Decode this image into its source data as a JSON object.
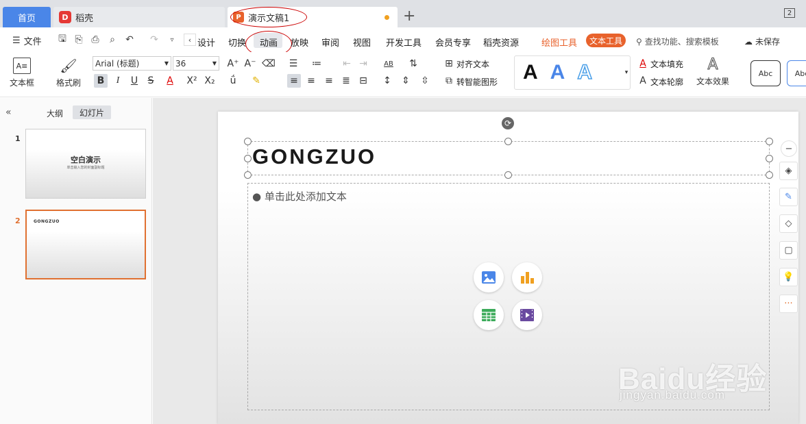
{
  "tabs": {
    "home": "首页",
    "daoke": "稻壳",
    "daoke_icon_letter": "D",
    "doc": "演示文稿1",
    "doc_icon_letter": "P",
    "add": "+",
    "window_num": "2"
  },
  "menu": {
    "file": "文件",
    "items": [
      "设计",
      "切换",
      "动画",
      "放映",
      "审阅",
      "视图",
      "开发工具",
      "会员专享",
      "稻壳资源"
    ],
    "drawing_tools": "绘图工具",
    "text_tools": "文本工具",
    "search_placeholder": "查找功能、搜索模板",
    "unsaved": "未保存"
  },
  "ribbon": {
    "textbox": "文本框",
    "format_painter": "格式刷",
    "font_name": "Arial (标题)",
    "font_size": "36",
    "align_text": "对齐文本",
    "smart_shape": "转智能图形",
    "text_fill": "文本填充",
    "text_outline": "文本轮廓",
    "text_effect": "文本效果",
    "wordart_letter": "A",
    "style1": "Abc",
    "style2": "Abc"
  },
  "left_pane": {
    "outline_tab": "大纲",
    "slides_tab": "幻灯片",
    "slides": [
      {
        "num": "1",
        "title": "空白演示",
        "subtitle": "单击输入您的封面副标题"
      },
      {
        "num": "2",
        "title": "GONGZUO"
      }
    ]
  },
  "slide": {
    "title": "GONGZUO",
    "body_placeholder": "单击此处添加文本"
  },
  "watermark": {
    "brand": "Baidu经验",
    "url": "jingyan.baidu.com"
  }
}
